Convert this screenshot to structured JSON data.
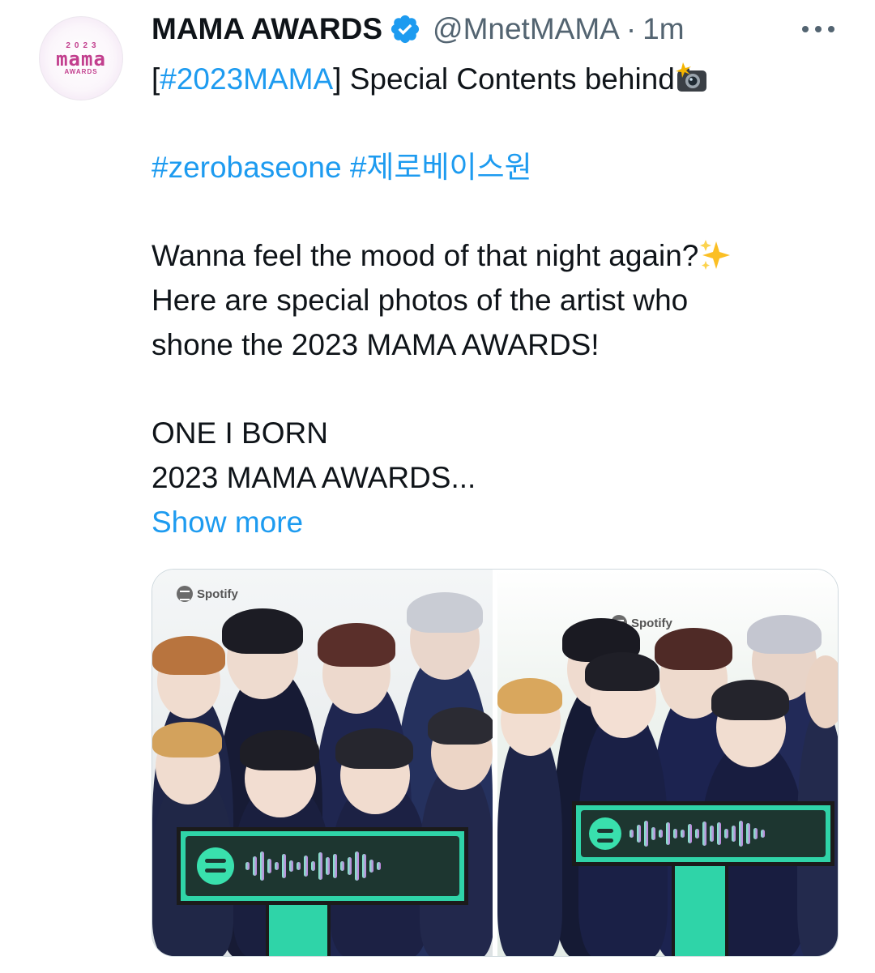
{
  "tweet": {
    "author_name": "MAMA AWARDS",
    "handle": "@MnetMAMA",
    "separator": "·",
    "time": "1m",
    "avatar": {
      "year": "2023",
      "logo": "mama",
      "sub": "AWARDS"
    },
    "lines": {
      "l1_open": "[",
      "l1_tag": "#2023MAMA",
      "l1_text": "] Special Contents behind",
      "l1_emoji": "camera-with-flash-icon",
      "tag_a": "#zerobaseone",
      "tag_b": "#제로베이스원",
      "l3_text": "Wanna feel the mood of that night again?",
      "l3_emoji": "sparkles-icon",
      "l4_text": "Here are special photos of the artist who",
      "l5_text": "shone the 2023 MAMA AWARDS!",
      "l6_text": "ONE I BORN",
      "l7_text": "2023 MAMA AWARDS..."
    },
    "show_more": "Show more",
    "media": {
      "left_watermark": "Spotify",
      "right_watermark": "Spotify"
    }
  },
  "colors": {
    "link": "#1d9bf0",
    "text": "#0f1419",
    "muted": "#536471",
    "verified": "#1d9bf0"
  }
}
